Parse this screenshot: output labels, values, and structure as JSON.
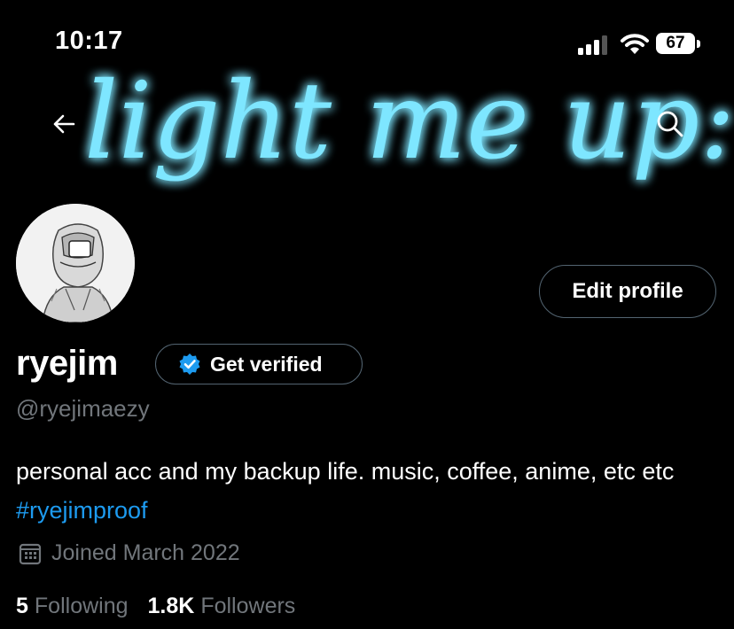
{
  "status_bar": {
    "time": "10:17",
    "battery_level": "67"
  },
  "banner": {
    "neon_text": "light me up:"
  },
  "profile": {
    "display_name": "ryejim",
    "handle": "@ryejimaezy",
    "edit_profile_label": "Edit profile",
    "get_verified_label": "Get verified",
    "bio_text": "personal acc and my backup life. music, coffee, anime, etc etc ",
    "bio_hashtag": "#ryejimproof",
    "joined": "Joined March 2022",
    "following_count": "5",
    "following_label": "Following",
    "followers_count": "1.8K",
    "followers_label": "Followers"
  },
  "colors": {
    "background": "#000000",
    "link_blue": "#1d9bf0",
    "muted_text": "#71767b",
    "border": "#536471",
    "neon": "#7ee6ff"
  },
  "icons": {
    "back": "arrow-left-icon",
    "search": "search-icon",
    "verified": "verified-badge-icon",
    "calendar": "calendar-icon",
    "signal": "cellular-signal-icon",
    "wifi": "wifi-icon",
    "battery": "battery-icon"
  }
}
